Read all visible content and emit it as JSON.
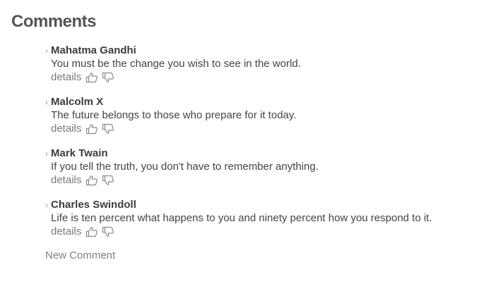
{
  "heading": "Comments",
  "comments": [
    {
      "author": "Mahatma Gandhi",
      "text": "You must be the change you wish to see in the world.",
      "details": "details"
    },
    {
      "author": "Malcolm X",
      "text": "The future belongs to those who prepare for it today.",
      "details": "details"
    },
    {
      "author": "Mark Twain",
      "text": "If you tell the truth, you don't have to remember anything.",
      "details": "details"
    },
    {
      "author": "Charles Swindoll",
      "text": "Life is ten percent what happens to you and ninety percent how you respond to it.",
      "details": "details"
    }
  ],
  "chevron": "›",
  "icons": {
    "like": "thumbs-up-icon",
    "dislike": "thumbs-down-icon"
  },
  "new_comment_label": "New Comment"
}
